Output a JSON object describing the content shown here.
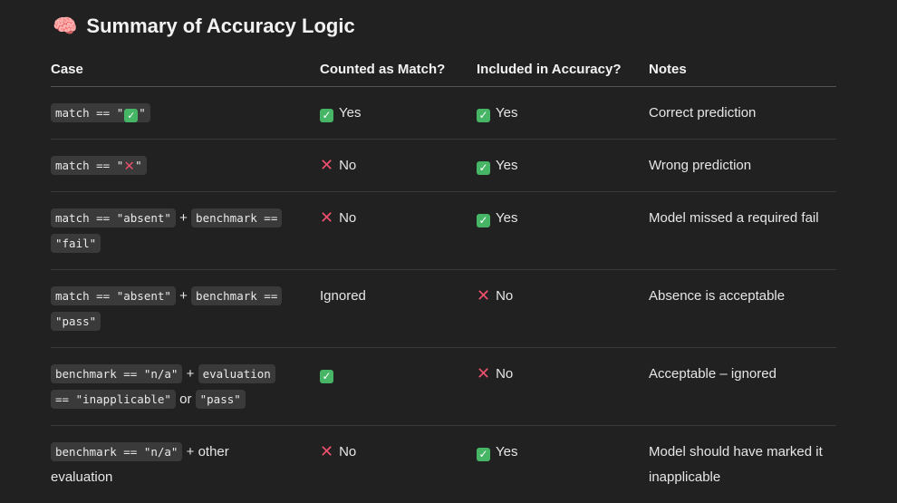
{
  "title": "Summary of Accuracy Logic",
  "headers": [
    "Case",
    "Counted as Match?",
    "Included in Accuracy?",
    "Notes"
  ],
  "rows": [
    {
      "case": {
        "code1_pre": "match == \"",
        "code1_icon": "check-icon",
        "code1_post": "\""
      },
      "match": {
        "icon": "check-icon",
        "text": "Yes"
      },
      "accuracy": {
        "icon": "check-icon",
        "text": "Yes"
      },
      "notes": "Correct prediction"
    },
    {
      "case": {
        "code1_pre": "match == \"",
        "code1_icon": "cross-icon",
        "code1_post": "\""
      },
      "match": {
        "icon": "cross-icon",
        "text": "No"
      },
      "accuracy": {
        "icon": "check-icon",
        "text": "Yes"
      },
      "notes": "Wrong prediction"
    },
    {
      "case": {
        "code1": "match == \"absent\"",
        "joiner": "+",
        "code2": "benchmark ==",
        "code3": "\"fail\""
      },
      "match": {
        "icon": "cross-icon",
        "text": "No"
      },
      "accuracy": {
        "icon": "check-icon",
        "text": "Yes"
      },
      "notes": "Model missed a required fail"
    },
    {
      "case": {
        "code1": "match == \"absent\"",
        "joiner": "+",
        "code2": "benchmark ==",
        "code3": "\"pass\""
      },
      "match": {
        "text": "Ignored"
      },
      "accuracy": {
        "icon": "cross-icon",
        "text": "No"
      },
      "notes": "Absence is acceptable"
    },
    {
      "case": {
        "code1": "benchmark == \"n/a\"",
        "joiner": "+",
        "code2": "evaluation",
        "code3": "== \"inapplicable\"",
        "or": "or",
        "code4": "\"pass\""
      },
      "match": {
        "icon": "check-icon"
      },
      "accuracy": {
        "icon": "cross-icon",
        "text": "No"
      },
      "notes": "Acceptable – ignored"
    },
    {
      "case": {
        "code1": "benchmark == \"n/a\"",
        "text": "+ other",
        "text2": "evaluation"
      },
      "match": {
        "icon": "cross-icon",
        "text": "No"
      },
      "accuracy": {
        "icon": "check-icon",
        "text": "Yes"
      },
      "notes": "Model should have marked it inapplicable"
    }
  ],
  "colors": {
    "check": "#46b566",
    "cross": "#f0506e",
    "background": "#212121"
  }
}
